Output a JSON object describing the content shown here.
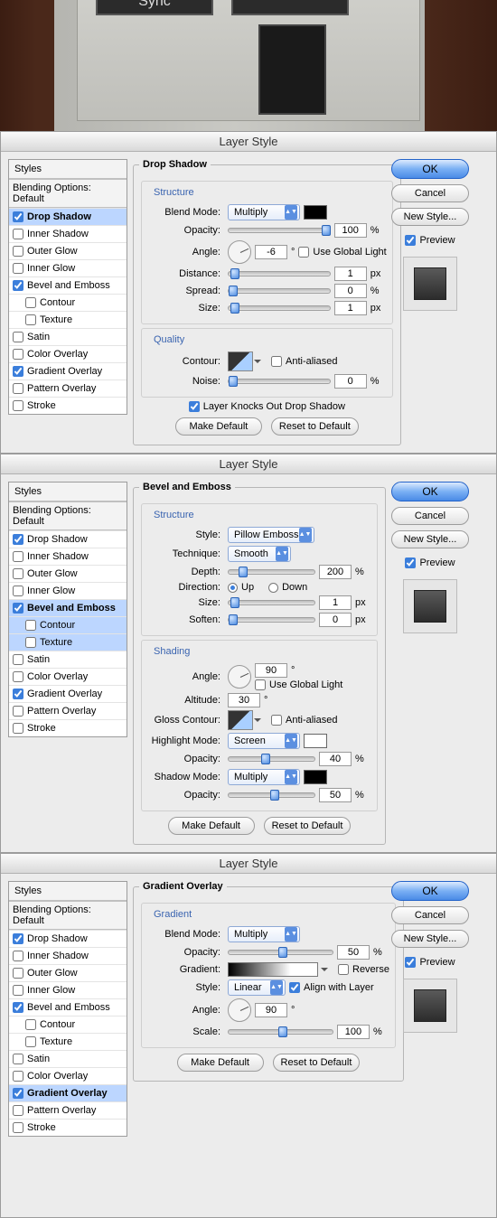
{
  "top": {
    "sync_label": "Sync"
  },
  "common": {
    "dialog_title": "Layer Style",
    "ok": "OK",
    "cancel": "Cancel",
    "new_style": "New Style...",
    "preview": "Preview",
    "make_default": "Make Default",
    "reset_default": "Reset to Default",
    "styles_hdr": "Styles",
    "blending_opts": "Blending Options: Default",
    "eff": {
      "drop_shadow": "Drop Shadow",
      "inner_shadow": "Inner Shadow",
      "outer_glow": "Outer Glow",
      "inner_glow": "Inner Glow",
      "bevel_emboss": "Bevel and Emboss",
      "contour": "Contour",
      "texture": "Texture",
      "satin": "Satin",
      "color_overlay": "Color Overlay",
      "gradient_overlay": "Gradient Overlay",
      "pattern_overlay": "Pattern Overlay",
      "stroke": "Stroke"
    }
  },
  "p1": {
    "legend": "Drop Shadow",
    "structure": "Structure",
    "blend_mode_lbl": "Blend Mode:",
    "blend_mode": "Multiply",
    "opacity_lbl": "Opacity:",
    "opacity": "100",
    "pct": "%",
    "angle_lbl": "Angle:",
    "angle": "-6",
    "deg": "°",
    "use_global": "Use Global Light",
    "distance_lbl": "Distance:",
    "distance": "1",
    "px": "px",
    "spread_lbl": "Spread:",
    "spread": "0",
    "size_lbl": "Size:",
    "size": "1",
    "quality": "Quality",
    "contour_lbl": "Contour:",
    "anti": "Anti-aliased",
    "noise_lbl": "Noise:",
    "noise": "0",
    "knocks": "Layer Knocks Out Drop Shadow"
  },
  "p2": {
    "legend": "Bevel and Emboss",
    "structure": "Structure",
    "style_lbl": "Style:",
    "style": "Pillow Emboss",
    "tech_lbl": "Technique:",
    "tech": "Smooth",
    "depth_lbl": "Depth:",
    "depth": "200",
    "pct": "%",
    "dir_lbl": "Direction:",
    "up": "Up",
    "down": "Down",
    "size_lbl": "Size:",
    "size": "1",
    "px": "px",
    "soften_lbl": "Soften:",
    "soften": "0",
    "shading": "Shading",
    "angle_lbl": "Angle:",
    "angle": "90",
    "use_global": "Use Global Light",
    "altitude_lbl": "Altitude:",
    "altitude": "30",
    "gloss_lbl": "Gloss Contour:",
    "anti": "Anti-aliased",
    "hmode_lbl": "Highlight Mode:",
    "hmode": "Screen",
    "hop_lbl": "Opacity:",
    "hop": "40",
    "smode_lbl": "Shadow Mode:",
    "smode": "Multiply",
    "sop_lbl": "Opacity:",
    "sop": "50"
  },
  "p3": {
    "legend": "Gradient Overlay",
    "gradient_hdr": "Gradient",
    "blend_mode_lbl": "Blend Mode:",
    "blend_mode": "Multiply",
    "opacity_lbl": "Opacity:",
    "opacity": "50",
    "pct": "%",
    "gradient_lbl": "Gradient:",
    "reverse": "Reverse",
    "style_lbl": "Style:",
    "style": "Linear",
    "align": "Align with Layer",
    "angle_lbl": "Angle:",
    "angle": "90",
    "deg": "°",
    "scale_lbl": "Scale:",
    "scale": "100"
  }
}
